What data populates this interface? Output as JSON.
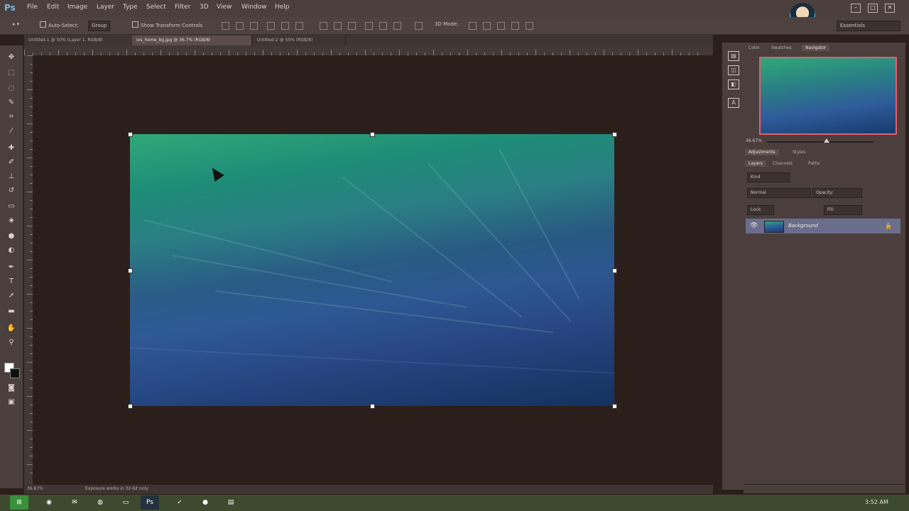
{
  "app": {
    "logo": "Ps"
  },
  "menu": [
    "File",
    "Edit",
    "Image",
    "Layer",
    "Type",
    "Select",
    "Filter",
    "3D",
    "View",
    "Window",
    "Help"
  ],
  "window_controls": [
    "–",
    "□",
    "✕"
  ],
  "options_bar": {
    "auto_select_label": "Auto-Select:",
    "auto_select_value": "Group",
    "show_transform_label": "Show Transform Controls",
    "mode_3d": "3D Mode:",
    "workspace": "Essentials"
  },
  "tabs": [
    {
      "label": "Untitled-1 @ 50% (Layer 1, RGB/8)"
    },
    {
      "label": "ios_home_bg.jpg @ 36.7% (RGB/8)"
    },
    {
      "label": "Untitled-2 @ 50% (RGB/8)"
    }
  ],
  "navigator": {
    "tabs": [
      "Color",
      "Swatches",
      "Navigator"
    ],
    "zoom": "36.67%"
  },
  "adjustments": {
    "tabs": [
      "Adjustments",
      "Styles"
    ]
  },
  "layers": {
    "tabs": [
      "Layers",
      "Channels",
      "Paths"
    ],
    "kind_filter": "Kind",
    "blend_mode": "Normal",
    "opacity_label": "Opacity:",
    "lock_label": "Lock:",
    "fill_label": "Fill:",
    "items": [
      {
        "name": "Background",
        "visible": true,
        "locked": true
      }
    ]
  },
  "status": {
    "zoom": "36.67%",
    "info": "Exposure works in 32-bit only"
  },
  "taskbar": {
    "clock": "3:52 AM"
  },
  "colors": {
    "menubar": "#4a3f3c",
    "canvas_bg": "#2b1f1c",
    "selected_layer": "#6a6d8c",
    "nav_frame": "#e0606a",
    "taskbar": "#3e4a2e"
  }
}
